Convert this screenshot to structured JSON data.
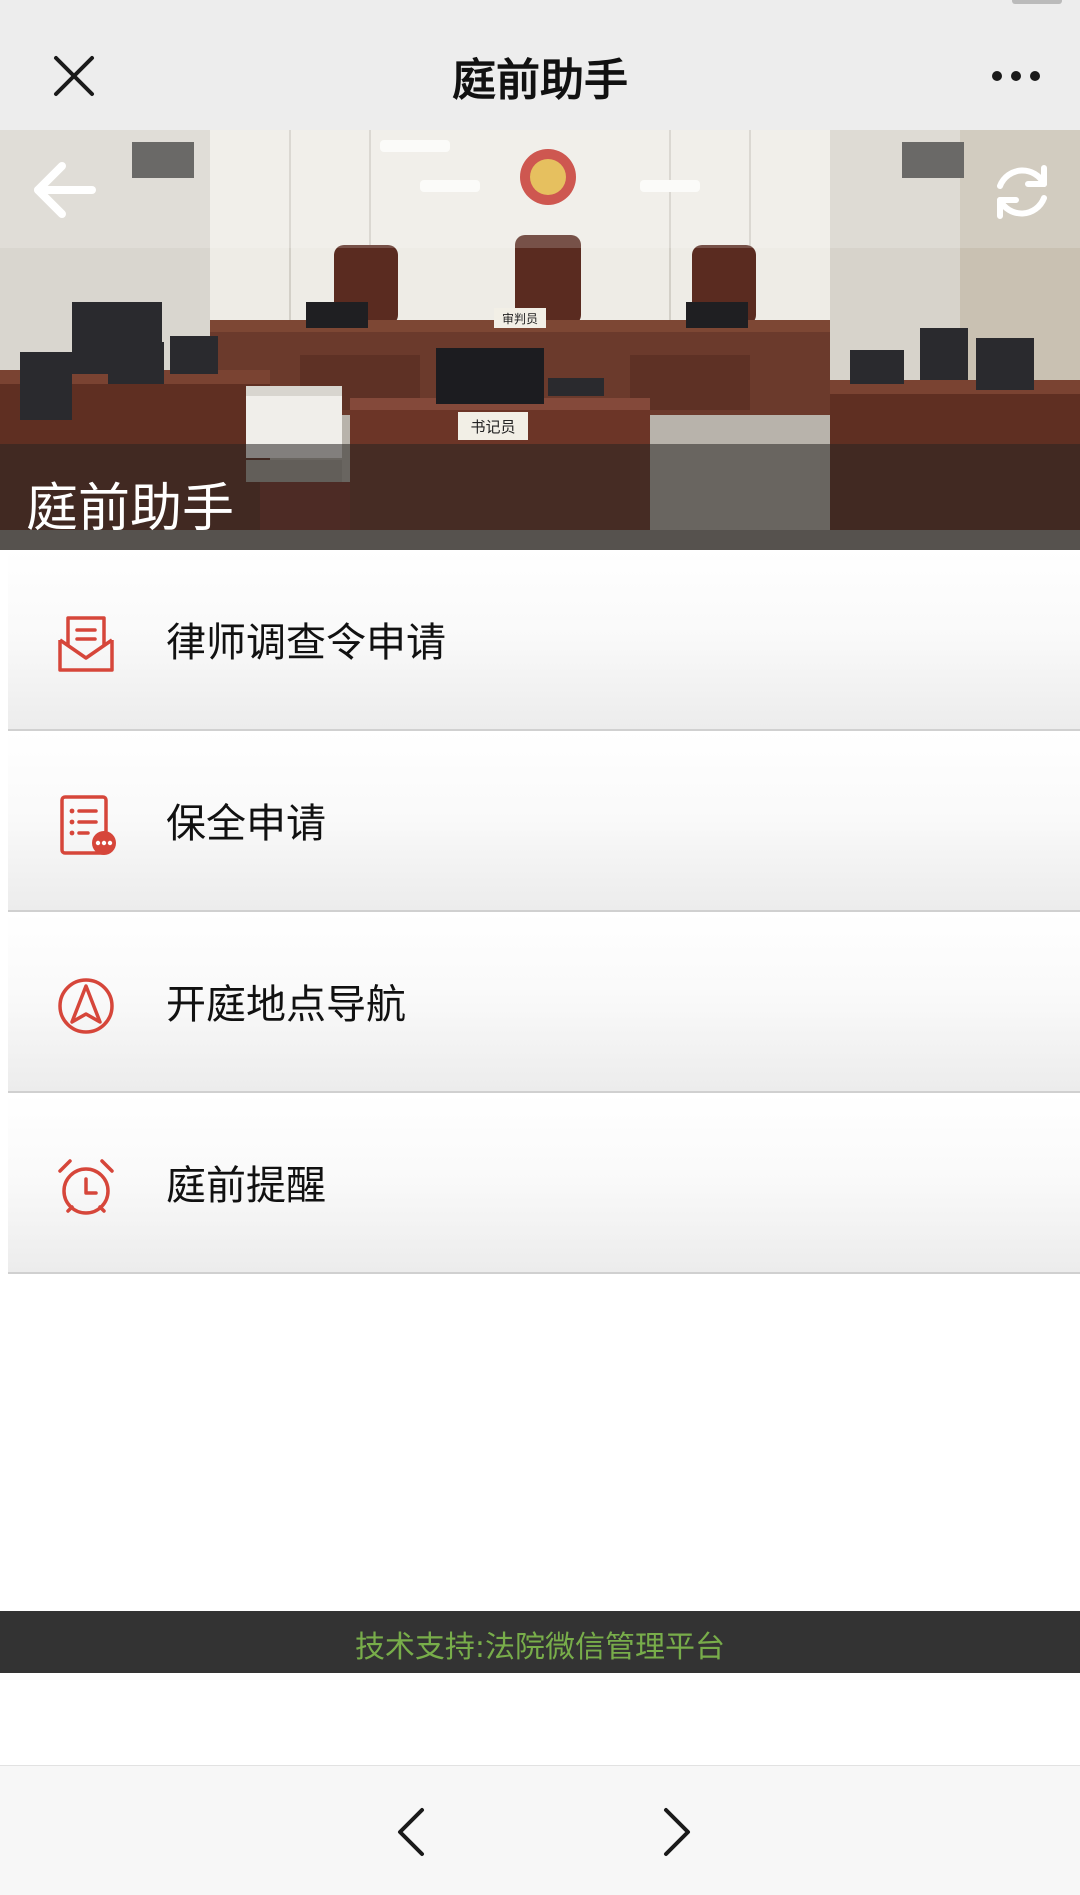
{
  "title_bar": {
    "title": "庭前助手",
    "close_icon": "close-icon",
    "more_icon": "more-dots-icon"
  },
  "hero": {
    "title": "庭前助手",
    "back_icon": "arrow-left-icon",
    "refresh_icon": "refresh-icon",
    "sign_judge": "审判员",
    "sign_clerk": "书记员"
  },
  "menu": {
    "items": [
      {
        "label": "律师调查令申请",
        "icon": "envelope-document-icon"
      },
      {
        "label": "保全申请",
        "icon": "form-list-icon"
      },
      {
        "label": "开庭地点导航",
        "icon": "navigation-icon"
      },
      {
        "label": "庭前提醒",
        "icon": "alarm-clock-icon"
      }
    ]
  },
  "footer": {
    "text": "技术支持:法院微信管理平台"
  },
  "bottom_nav": {
    "back_icon": "chevron-left-icon",
    "forward_icon": "chevron-right-icon"
  },
  "colors": {
    "accent": "#d6463a",
    "footer_text": "#78ad4a",
    "footer_bg": "#333333",
    "title_bar_bg": "#ededed"
  }
}
